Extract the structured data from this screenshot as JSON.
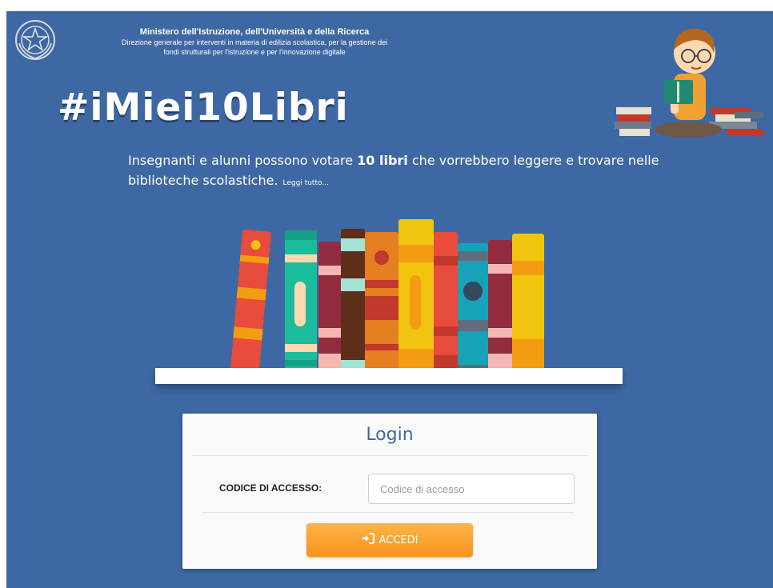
{
  "header": {
    "ministry": "Ministero dell'Istruzione, dell'Università e della Ricerca",
    "direction_line1": "Direzione generale per interventi in materia di edilizia scolastica, per la gestione dei",
    "direction_line2": "fondi strutturali per l'istruzione e per l'innovazione digitale",
    "emblem_icon": "italian-republic-emblem-icon"
  },
  "hashtag": "#iMiei10Libri",
  "intro": {
    "text_before": "Insegnanti e alunni possono votare ",
    "highlight": "10 libri",
    "text_after": " che vorrebbero leggere e trovare nelle biblioteche scolastiche.",
    "read_more": "Leggi tutto..."
  },
  "login": {
    "title": "Login",
    "code_label": "CODICE DI ACCESSO:",
    "code_placeholder": "Codice di accesso",
    "code_value": "",
    "submit_label": "ACCEDI",
    "submit_icon": "sign-in-icon"
  },
  "colors": {
    "background": "#3e68a3",
    "button": "#f7941d",
    "title": "#3e68a3"
  }
}
